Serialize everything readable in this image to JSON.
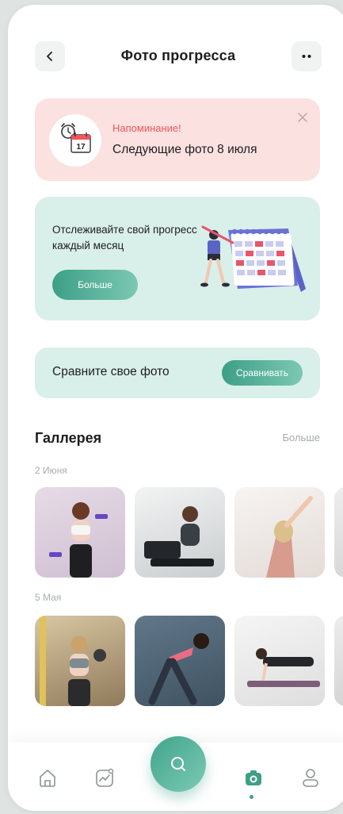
{
  "header": {
    "title": "Фото прогресса"
  },
  "reminder": {
    "label": "Напоминание!",
    "text": "Следующие фото 8 июля",
    "calendar_day": "17"
  },
  "track_card": {
    "text": "Отслеживайте свой прогресс каждый месяц",
    "button_label": "Больше"
  },
  "compare_card": {
    "text": "Сравните свое фото",
    "button_label": "Сравнивать"
  },
  "gallery": {
    "title": "Галлерея",
    "more_label": "Больше",
    "groups": [
      {
        "date": "2 Июня"
      },
      {
        "date": "5 Мая"
      }
    ]
  },
  "colors": {
    "accent": "#3e9f88",
    "reminder_bg": "#fbe1e0",
    "reminder_label": "#f2555a",
    "card_bg": "#d9efea"
  },
  "nav": {
    "items": [
      "home-icon",
      "progress-chart-icon",
      "search-icon",
      "camera-icon",
      "profile-icon"
    ],
    "active": "camera-icon"
  }
}
